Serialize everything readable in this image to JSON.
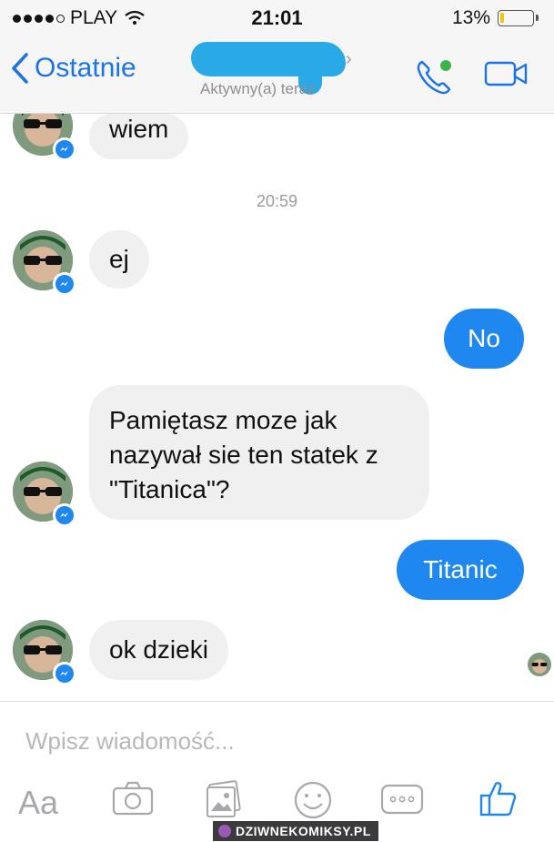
{
  "status_bar": {
    "carrier": "PLAY",
    "time": "21:01",
    "battery": "13%",
    "battery_level": 0.13
  },
  "header": {
    "back_label": "Ostatnie",
    "active_status": "Aktywny(a) teraz"
  },
  "messages": {
    "m1": "wiem",
    "timestamp": "20:59",
    "m2": "ej",
    "m3": "No",
    "m4_line1": "Pamiętasz moze jak",
    "m4_line2": "nazywał sie ten statek z",
    "m4_line3": "\"Titanica\"?",
    "m5": "Titanic",
    "m6": "ok dzieki"
  },
  "composer": {
    "placeholder": "Wpisz wiadomość...",
    "aa_label": "Aa"
  },
  "watermark": "DZIWNEKOMIKSY.PL",
  "colors": {
    "accent": "#1e88f0",
    "incoming_bubble": "#f0f0f1",
    "header_bg": "#f6f6f7"
  }
}
